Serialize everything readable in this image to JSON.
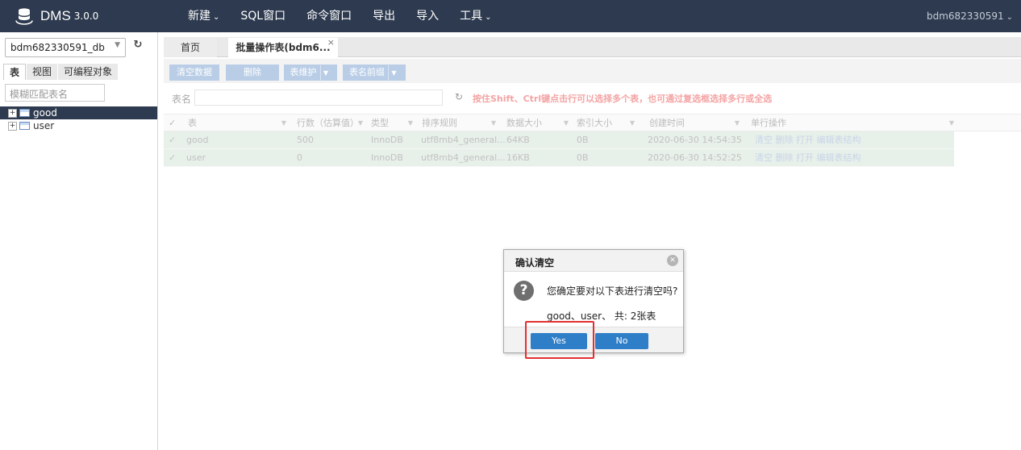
{
  "app": {
    "brand": "DMS",
    "version": "3.0.0",
    "user": "bdm682330591"
  },
  "menu": [
    "新建",
    "SQL窗口",
    "命令窗口",
    "导出",
    "导入",
    "工具"
  ],
  "sidebar": {
    "db": "bdm682330591_db",
    "tabs": [
      "表",
      "视图",
      "可编程对象"
    ],
    "search_placeholder": "模糊匹配表名",
    "tree": [
      "good",
      "user"
    ]
  },
  "tabs": {
    "home": "首页",
    "batch": "批量操作表(bdm6...",
    "close": "×"
  },
  "toolbar": {
    "clear": "清空数据",
    "delete": "删除",
    "maintain": "表维护",
    "prefix": "表名前缀"
  },
  "filter": {
    "label": "表名",
    "hint": "按住Shift、Ctrl键点击行可以选择多个表，也可通过复选框选择多行或全选"
  },
  "columns": [
    "表",
    "行数（估算值）",
    "类型",
    "排序规则",
    "数据大小",
    "索引大小",
    "创建时间",
    "单行操作"
  ],
  "rows": [
    {
      "name": "good",
      "rows": "500",
      "type": "InnoDB",
      "collation": "utf8mb4_general...",
      "data": "64KB",
      "index": "0B",
      "created": "2020-06-30 14:54:35",
      "ops": "清空 删除 打开 编辑表结构"
    },
    {
      "name": "user",
      "rows": "0",
      "type": "InnoDB",
      "collation": "utf8mb4_general...",
      "data": "16KB",
      "index": "0B",
      "created": "2020-06-30 14:52:25",
      "ops": "清空 删除 打开 编辑表结构"
    }
  ],
  "dialog": {
    "title": "确认清空",
    "message": "您确定要对以下表进行清空吗?",
    "detail": "good、user、 共: 2张表",
    "yes": "Yes",
    "no": "No"
  }
}
